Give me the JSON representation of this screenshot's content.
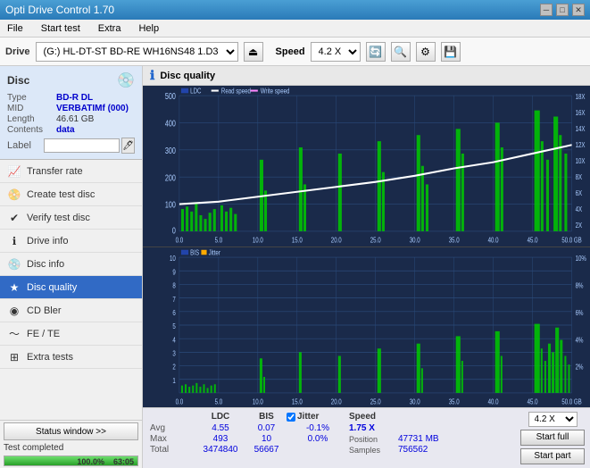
{
  "titleBar": {
    "title": "Opti Drive Control 1.70",
    "minBtn": "─",
    "maxBtn": "□",
    "closeBtn": "✕"
  },
  "menuBar": {
    "items": [
      "File",
      "Start test",
      "Extra",
      "Help"
    ]
  },
  "toolbar": {
    "driveLabel": "Drive",
    "driveValue": "(G:)  HL-DT-ST BD-RE  WH16NS48 1.D3",
    "speedLabel": "Speed",
    "speedValue": "4.2 X"
  },
  "disc": {
    "sectionLabel": "Disc",
    "typeLabel": "Type",
    "typeValue": "BD-R DL",
    "midLabel": "MID",
    "midValue": "VERBATIMf (000)",
    "lengthLabel": "Length",
    "lengthValue": "46.61 GB",
    "contentsLabel": "Contents",
    "contentsValue": "data",
    "labelLabel": "Label",
    "labelValue": ""
  },
  "nav": {
    "items": [
      {
        "id": "transfer-rate",
        "label": "Transfer rate",
        "icon": "⟶"
      },
      {
        "id": "create-test-disc",
        "label": "Create test disc",
        "icon": "+"
      },
      {
        "id": "verify-test-disc",
        "label": "Verify test disc",
        "icon": "✓"
      },
      {
        "id": "drive-info",
        "label": "Drive info",
        "icon": "i"
      },
      {
        "id": "disc-info",
        "label": "Disc info",
        "icon": "💿"
      },
      {
        "id": "disc-quality",
        "label": "Disc quality",
        "icon": "★",
        "active": true
      },
      {
        "id": "cd-bler",
        "label": "CD Bler",
        "icon": "◉"
      },
      {
        "id": "fe-te",
        "label": "FE / TE",
        "icon": "~"
      },
      {
        "id": "extra-tests",
        "label": "Extra tests",
        "icon": "⊞"
      }
    ]
  },
  "statusBar": {
    "btnLabel": "Status window >>",
    "statusText": "Test completed",
    "progressValue": 100,
    "progressLabel": "100.0%",
    "timeLabel": "63:05"
  },
  "discQuality": {
    "headerIcon": "ℹ",
    "headerLabel": "Disc quality"
  },
  "chart1": {
    "legend": {
      "ldc": "LDC",
      "readSpeed": "Read speed",
      "writeSpeed": "Write speed"
    },
    "yAxisLabels": [
      "500",
      "400",
      "300",
      "200",
      "100",
      "0"
    ],
    "yAxisRight": [
      "18X",
      "16X",
      "14X",
      "12X",
      "10X",
      "8X",
      "6X",
      "4X",
      "2X"
    ],
    "xAxisLabels": [
      "0.0",
      "5.0",
      "10.0",
      "15.0",
      "20.0",
      "25.0",
      "30.0",
      "35.0",
      "40.0",
      "45.0",
      "50.0 GB"
    ]
  },
  "chart2": {
    "legend": {
      "bis": "BIS",
      "jitter": "Jitter"
    },
    "yAxisLabels": [
      "10",
      "9",
      "8",
      "7",
      "6",
      "5",
      "4",
      "3",
      "2",
      "1"
    ],
    "yAxisRight": [
      "10%",
      "8%",
      "6%",
      "4%",
      "2%"
    ],
    "xAxisLabels": [
      "0.0",
      "5.0",
      "10.0",
      "15.0",
      "20.0",
      "25.0",
      "30.0",
      "35.0",
      "40.0",
      "45.0",
      "50.0 GB"
    ]
  },
  "stats": {
    "headers": {
      "ldc": "LDC",
      "bis": "BIS",
      "jitter": "Jitter",
      "speed": "Speed",
      "position": "Position"
    },
    "rows": {
      "avg": {
        "label": "Avg",
        "ldc": "4.55",
        "bis": "0.07",
        "jitter": "-0.1%",
        "speed": "1.75 X"
      },
      "max": {
        "label": "Max",
        "ldc": "493",
        "bis": "10",
        "jitter": "0.0%",
        "position": "47731 MB"
      },
      "total": {
        "label": "Total",
        "ldc": "3474840",
        "bis": "56667",
        "samples": "756562"
      }
    },
    "speedDisplay": "4.2 X",
    "jitterChecked": true,
    "positionLabel": "Position",
    "samplesLabel": "Samples"
  },
  "buttons": {
    "startFull": "Start full",
    "startPart": "Start part"
  }
}
